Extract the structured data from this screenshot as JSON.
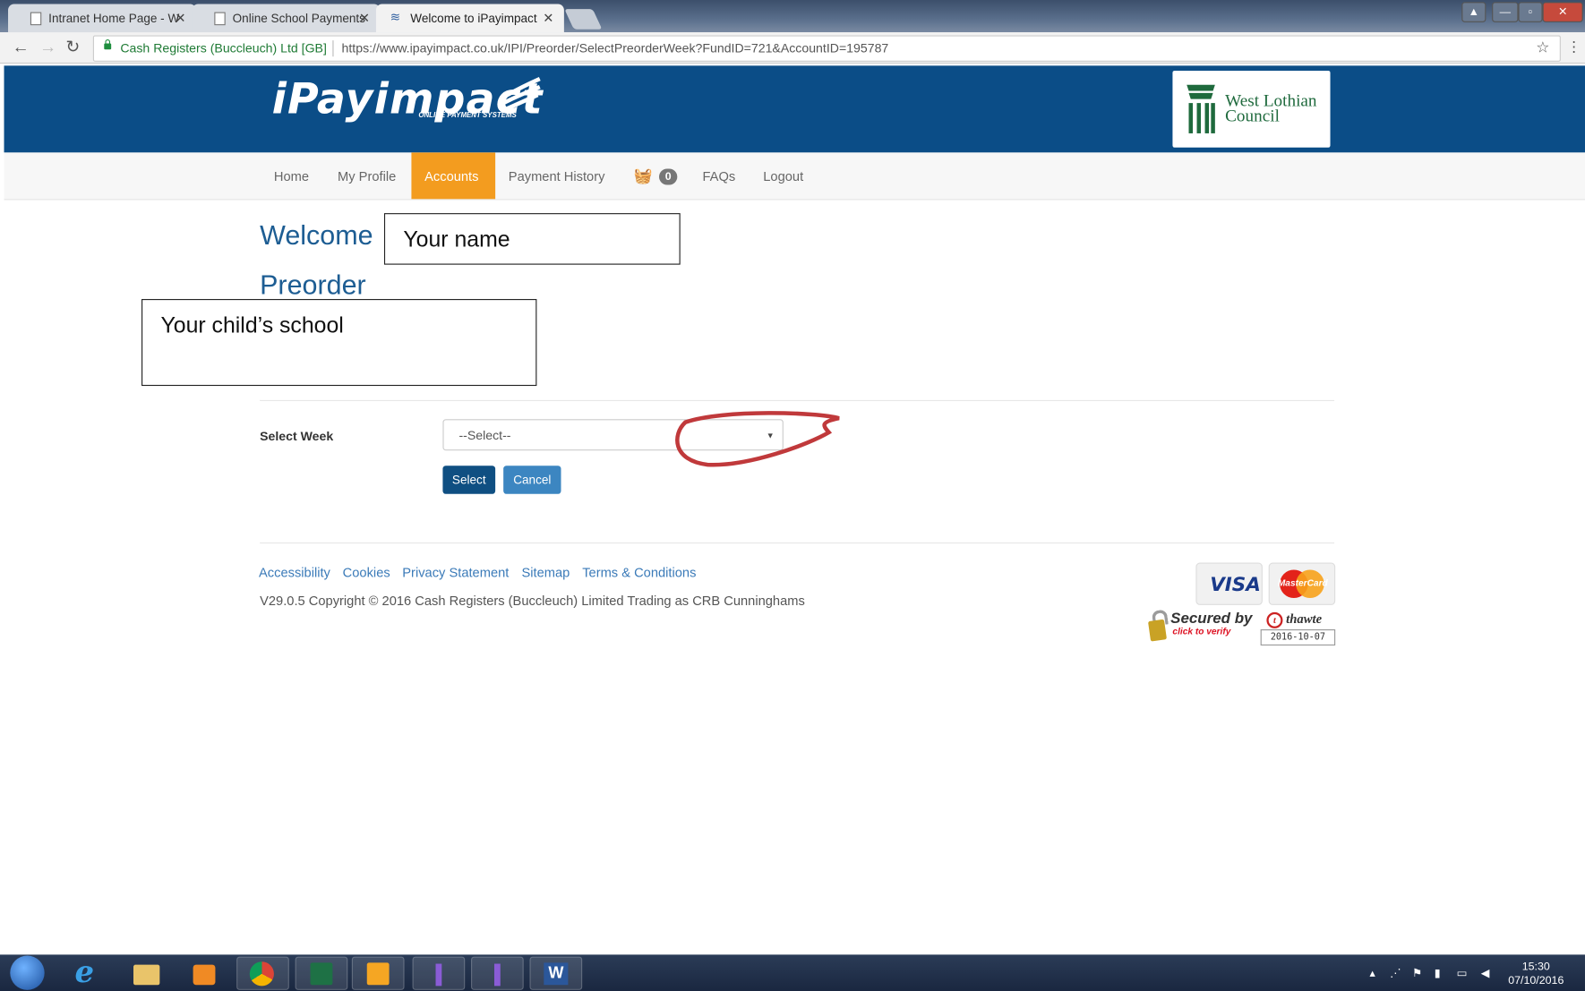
{
  "browser": {
    "tabs": [
      {
        "title": "Intranet Home Page - W"
      },
      {
        "title": "Online School Payments"
      },
      {
        "title": "Welcome to iPayimpact"
      }
    ],
    "secure_label": "Cash Registers (Buccleuch) Ltd [GB]",
    "url": "https://www.ipayimpact.co.uk/IPI/Preorder/SelectPreorderWeek?FundID=721&AccountID=195787"
  },
  "header": {
    "logo_text": "iPayimpact",
    "logo_sub": "ONLINE PAYMENT SYSTEMS",
    "council_line1": "West Lothian",
    "council_line2": "Council"
  },
  "nav": {
    "home": "Home",
    "profile": "My Profile",
    "accounts": "Accounts",
    "history": "Payment History",
    "basket_count": "0",
    "faqs": "FAQs",
    "logout": "Logout"
  },
  "content": {
    "welcome": "Welcome",
    "preorder": "Preorder",
    "name_note": "Your name",
    "school_note": "Your child’s school",
    "select_week_label": "Select Week",
    "select_placeholder": "--Select--",
    "select_button": "Select",
    "cancel_button": "Cancel"
  },
  "footer": {
    "links": [
      "Accessibility",
      "Cookies",
      "Privacy Statement",
      "Sitemap",
      "Terms & Conditions"
    ],
    "copyright": "V29.0.5 Copyright © 2016 Cash Registers (Buccleuch) Limited Trading as CRB Cunninghams",
    "visa": "VISA",
    "mastercard": "MasterCard",
    "secured_by": "Secured by",
    "thawte": "thawte",
    "click_verify": "click to verify",
    "seal_date": "2016-10-07"
  },
  "taskbar": {
    "time": "15:30",
    "date": "07/10/2016"
  },
  "colors": {
    "header_blue": "#0b4d87",
    "accent_orange": "#f39c1f",
    "primary_button": "#0f4f82",
    "cancel_button": "#3c86c1"
  }
}
